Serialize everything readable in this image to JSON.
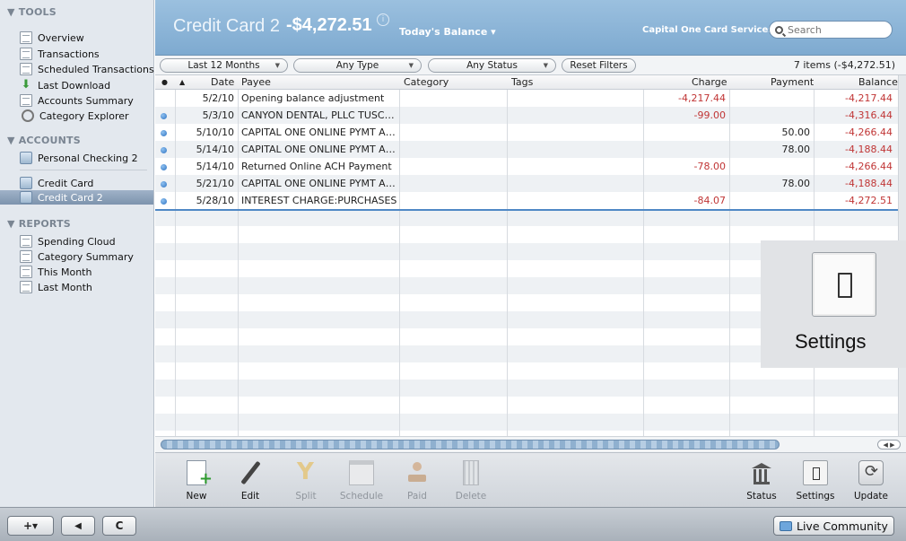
{
  "sidebar": {
    "tools_header": "▼ TOOLS",
    "tools": [
      {
        "label": "Overview",
        "icon": "overview-icon"
      },
      {
        "label": "Transactions",
        "icon": "transactions-icon"
      },
      {
        "label": "Scheduled Transactions",
        "icon": "scheduled-transactions-icon"
      },
      {
        "label": "Last Download",
        "icon": "download-arrow-icon"
      },
      {
        "label": "Accounts Summary",
        "icon": "accounts-summary-icon"
      },
      {
        "label": "Category Explorer",
        "icon": "magnifier-icon"
      }
    ],
    "accounts_header": "▼ ACCOUNTS",
    "accounts": [
      {
        "label": "Personal Checking 2",
        "icon": "account-icon"
      },
      {
        "label": "Credit Card",
        "icon": "account-icon"
      },
      {
        "label": "Credit Card 2",
        "icon": "account-icon",
        "selected": true
      }
    ],
    "reports_header": "▼ REPORTS",
    "reports": [
      {
        "label": "Spending Cloud",
        "icon": "report-icon"
      },
      {
        "label": "Category Summary",
        "icon": "report-icon"
      },
      {
        "label": "This Month",
        "icon": "report-icon"
      },
      {
        "label": "Last Month",
        "icon": "report-icon"
      }
    ]
  },
  "header": {
    "account_name": "Credit Card 2",
    "balance": "-$4,272.51",
    "balance_type": "Today's Balance ▾",
    "bank_name": "Capital One Card Services",
    "search_placeholder": "Search"
  },
  "filters": {
    "period": "Last 12 Months",
    "type": "Any Type",
    "status": "Any Status",
    "reset_label": "Reset Filters",
    "items_summary": "7 items (-$4,272.51)"
  },
  "table": {
    "columns": {
      "status": "●",
      "sort": "▲",
      "date": "Date",
      "payee": "Payee",
      "category": "Category",
      "tags": "Tags",
      "charge": "Charge",
      "payment": "Payment",
      "balance": "Balance"
    },
    "rows": [
      {
        "cleared": false,
        "date": "5/2/10",
        "payee": "Opening balance adjustment",
        "charge": "-4,217.44",
        "payment": "",
        "balance": "-4,217.44"
      },
      {
        "cleared": true,
        "date": "5/3/10",
        "payee": "CANYON DENTAL, PLLC TUSC…",
        "charge": "-99.00",
        "payment": "",
        "balance": "-4,316.44"
      },
      {
        "cleared": true,
        "date": "5/10/10",
        "payee": "CAPITAL ONE ONLINE PYMT A…",
        "charge": "",
        "payment": "50.00",
        "balance": "-4,266.44"
      },
      {
        "cleared": true,
        "date": "5/14/10",
        "payee": "CAPITAL ONE ONLINE PYMT A…",
        "charge": "",
        "payment": "78.00",
        "balance": "-4,188.44"
      },
      {
        "cleared": true,
        "date": "5/14/10",
        "payee": "Returned Online ACH Payment",
        "charge": "-78.00",
        "payment": "",
        "balance": "-4,266.44"
      },
      {
        "cleared": true,
        "date": "5/21/10",
        "payee": "CAPITAL ONE ONLINE PYMT A…",
        "charge": "",
        "payment": "78.00",
        "balance": "-4,188.44"
      },
      {
        "cleared": true,
        "date": "5/28/10",
        "payee": "INTEREST CHARGE:PURCHASES",
        "charge": "-84.07",
        "payment": "",
        "balance": "-4,272.51"
      }
    ]
  },
  "toolbar": {
    "new": "New",
    "edit": "Edit",
    "split": "Split",
    "schedule": "Schedule",
    "paid": "Paid",
    "delete": "Delete",
    "status": "Status",
    "settings": "Settings",
    "update": "Update"
  },
  "callout": {
    "label": "Settings"
  },
  "bottombar": {
    "add": "+▾",
    "back": "◀",
    "refresh": "C",
    "live_community": "Live Community"
  }
}
